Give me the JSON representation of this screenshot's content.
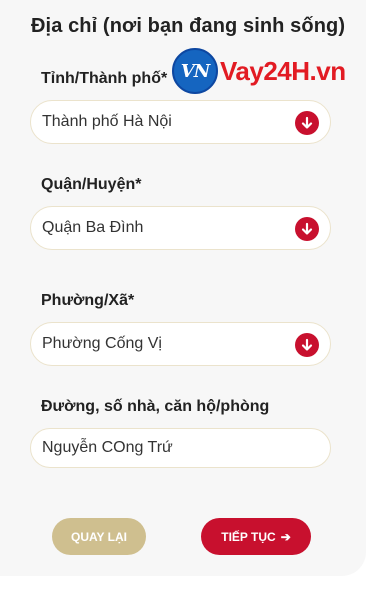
{
  "section": {
    "title": "Địa chỉ (nơi bạn đang sinh sống)"
  },
  "watermark": {
    "badge": "VN",
    "text": "Vay24H.vn"
  },
  "fields": {
    "province": {
      "label": "Tỉnh/Thành phố*",
      "value": "Thành phố Hà Nội"
    },
    "district": {
      "label": "Quận/Huyện*",
      "value": "Quận Ba Đình"
    },
    "ward": {
      "label": "Phường/Xã*",
      "value": "Phường Cống Vị"
    },
    "street": {
      "label": "Đường, số nhà, căn hộ/phòng",
      "value": "Nguyễn COng Trứ"
    }
  },
  "buttons": {
    "back": "QUAY LẠI",
    "next": "TIẾP TỤC",
    "next_arrow": "➔"
  },
  "colors": {
    "accent": "#c8102e",
    "back_button": "#cfbf8f",
    "card_bg": "#f7f7f7"
  }
}
